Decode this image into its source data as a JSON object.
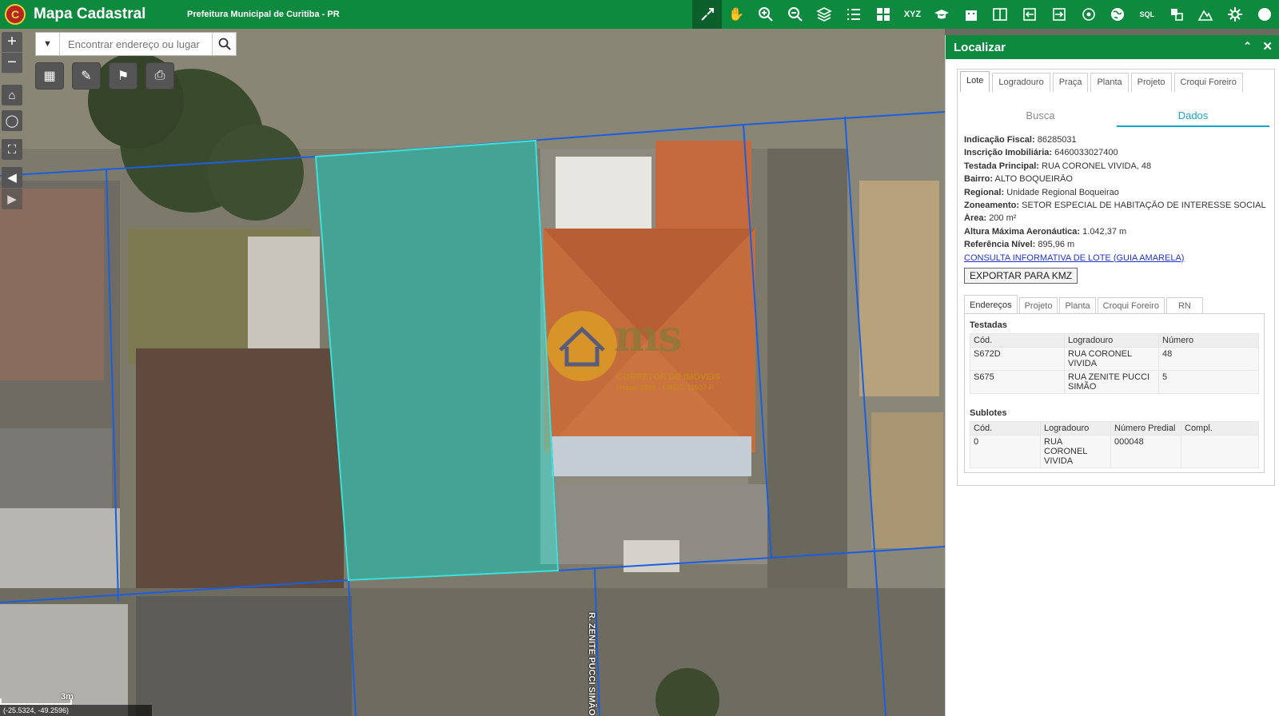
{
  "header": {
    "logo_text": "C",
    "title": "Mapa Cadastral",
    "subtitle": "Prefeitura Municipal de Curitiba - PR"
  },
  "toolbar": {
    "icons": [
      "locate-lot-icon",
      "pan-hand-icon",
      "zoom-in-icon",
      "zoom-out-icon",
      "layers-icon",
      "list-icon",
      "grid-icon",
      "xyz-icon",
      "education-icon",
      "building-icon",
      "split-view-icon",
      "import-icon",
      "export-icon",
      "gps-icon",
      "globe-icon",
      "sql-icon",
      "measure-area-icon",
      "terrain-icon",
      "settings-icon",
      "info-icon"
    ],
    "xyz_label": "XYZ",
    "sql_label": "SQL"
  },
  "map": {
    "search_placeholder": "Encontrar endereço ou lugar",
    "scale_label": "3m",
    "coords": "(-25.5324, -49.2596)",
    "street_label": "R. ZENITE PUCCI SIMÃO",
    "watermark": {
      "logo": "ms",
      "line1": "CORRETOR DE IMÓVEIS",
      "line2": "Desde 1999 - CRECI 12607-F"
    },
    "colors": {
      "selection": "#3fe0d6",
      "lot_line": "#1a5fe0"
    }
  },
  "panel": {
    "title": "Localizar",
    "tabs": [
      "Lote",
      "Logradouro",
      "Praça",
      "Planta",
      "Projeto",
      "Croqui Foreiro"
    ],
    "active_tab": "Lote",
    "subtabs": [
      "Busca",
      "Dados"
    ],
    "active_subtab": "Dados",
    "info": [
      {
        "label": "Indicação Fiscal:",
        "value": "86285031"
      },
      {
        "label": "Inscrição Imobiliária:",
        "value": "6460033027400"
      },
      {
        "label": "Testada Principal:",
        "value": "RUA CORONEL VIVIDA, 48"
      },
      {
        "label": "Bairro:",
        "value": "ALTO BOQUEIRÃO"
      },
      {
        "label": "Regional:",
        "value": "Unidade Regional Boqueirao"
      },
      {
        "label": "Zoneamento:",
        "value": "SETOR ESPECIAL DE HABITAÇÃO DE INTERESSE SOCIAL"
      },
      {
        "label": "Área:",
        "value": "200 m²"
      },
      {
        "label": "Altura Máxima Aeronáutica:",
        "value": "1.042,37 m"
      },
      {
        "label": "Referência Nível:",
        "value": "895,96 m"
      }
    ],
    "link": "CONSULTA INFORMATIVA DE LOTE (GUIA AMARELA)",
    "export_button": "EXPORTAR PARA KMZ",
    "inner_tabs": [
      "Endereços",
      "Projeto",
      "Planta",
      "Croqui Foreiro",
      "RN"
    ],
    "active_inner_tab": "Endereços",
    "testadas": {
      "title": "Testadas",
      "headers": [
        "Cód.",
        "Logradouro",
        "Número"
      ],
      "rows": [
        [
          "S672D",
          "RUA CORONEL VIVIDA",
          "48"
        ],
        [
          "S675",
          "RUA ZENITE PUCCI SIMÃO",
          "5"
        ]
      ]
    },
    "sublotes": {
      "title": "Sublotes",
      "headers": [
        "Cód.",
        "Logradouro",
        "Número Predial",
        "Compl."
      ],
      "rows": [
        [
          "0",
          "RUA CORONEL VIVIDA",
          "000048",
          ""
        ]
      ]
    }
  }
}
